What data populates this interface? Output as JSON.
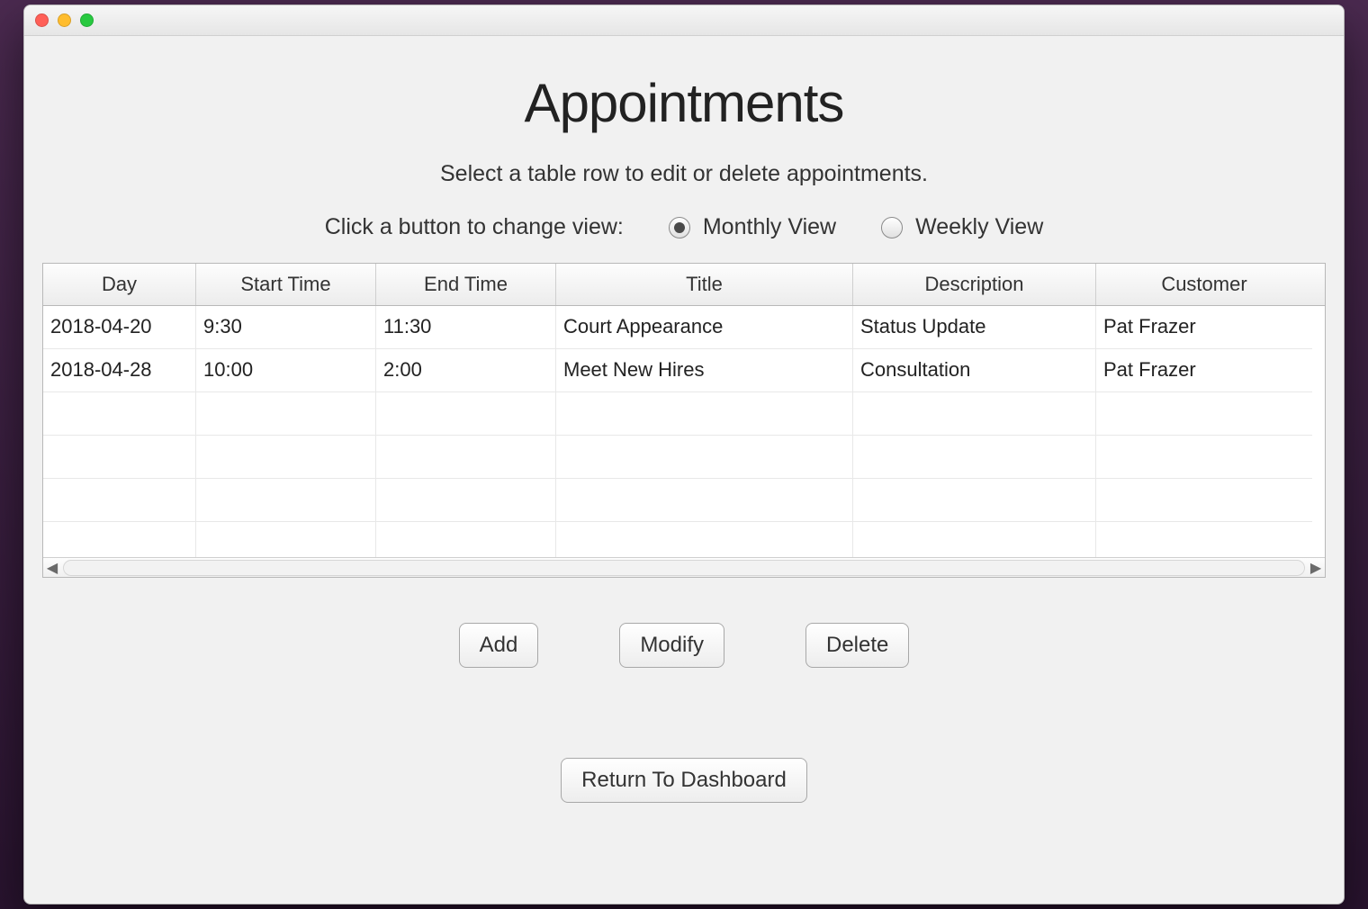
{
  "header": {
    "title": "Appointments",
    "hint": "Select a table row to edit or delete appointments."
  },
  "view": {
    "label": "Click a button to change view:",
    "options": [
      {
        "label": "Monthly View",
        "selected": true
      },
      {
        "label": "Weekly View",
        "selected": false
      }
    ]
  },
  "table": {
    "columns": [
      "Day",
      "Start Time",
      "End Time",
      "Title",
      "Description",
      "Customer"
    ],
    "rows": [
      {
        "day": "2018-04-20",
        "start": "9:30",
        "end": "11:30",
        "title": "Court Appearance",
        "description": "Status Update",
        "customer": "Pat Frazer"
      },
      {
        "day": "2018-04-28",
        "start": "10:00",
        "end": "2:00",
        "title": "Meet New Hires",
        "description": "Consultation",
        "customer": "Pat Frazer"
      }
    ],
    "visible_blank_rows": 4
  },
  "buttons": {
    "add": "Add",
    "modify": "Modify",
    "delete": "Delete",
    "return": "Return To Dashboard"
  }
}
